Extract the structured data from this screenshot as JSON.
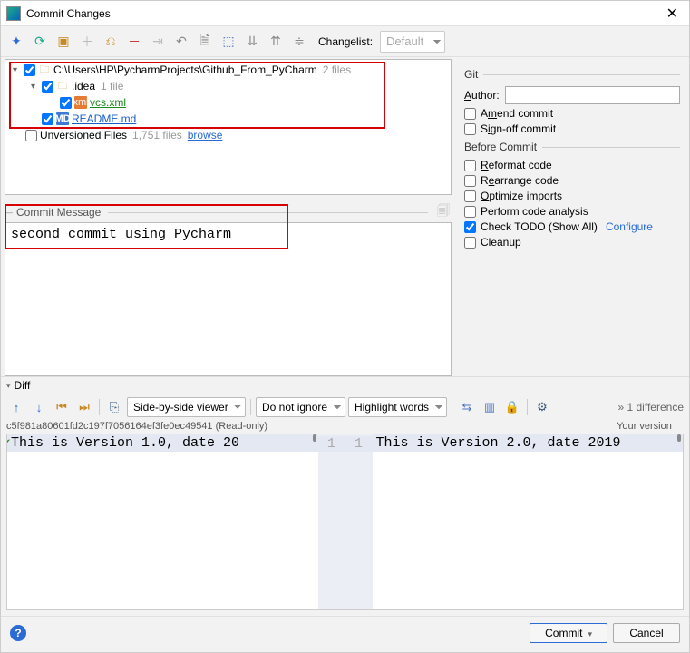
{
  "title": "Commit Changes",
  "toolbar": {
    "changelist_label": "Changelist:",
    "changelist_value": "Default"
  },
  "tree": {
    "root": {
      "path": "C:\\Users\\HP\\PycharmProjects\\Github_From_PyCharm",
      "count": "2 files"
    },
    "idea": {
      "name": ".idea",
      "count": "1 file"
    },
    "vcs": {
      "name": "vcs.xml"
    },
    "readme": {
      "name": "README.md"
    },
    "unversioned": {
      "label": "Unversioned Files",
      "count": "1,751 files",
      "browse": "browse"
    }
  },
  "commit_message": {
    "label": "Commit Message",
    "value": "second commit using Pycharm"
  },
  "right": {
    "git_label": "Git",
    "author_label": "Author:",
    "author_value": "",
    "amend": "mend commit",
    "signoff": "ign-off commit",
    "before_label": "Before Commit",
    "reformat": "eformat code",
    "rearrange": "Rearrange code",
    "optimize": "ptimize imports",
    "analysis": "Perform code analysis",
    "todo": "Check TODO (Show All)",
    "configure": "Configure",
    "cleanup": "Cleanup"
  },
  "diff": {
    "label": "Diff",
    "viewer": "Side-by-side viewer",
    "ignore": "Do not ignore",
    "highlight": "Highlight words",
    "hash": "c5f981a80601fd2c197f7056164ef3fe0ec49541 (Read-only)",
    "your_version": "Your version",
    "count": "1 difference",
    "left_line": "This is Version 1.0, date 20",
    "right_line": "This is Version 2.0, date 2019",
    "lineno_left": "1",
    "lineno_right": "1"
  },
  "buttons": {
    "commit": "Commit",
    "cancel": "Cancel"
  }
}
